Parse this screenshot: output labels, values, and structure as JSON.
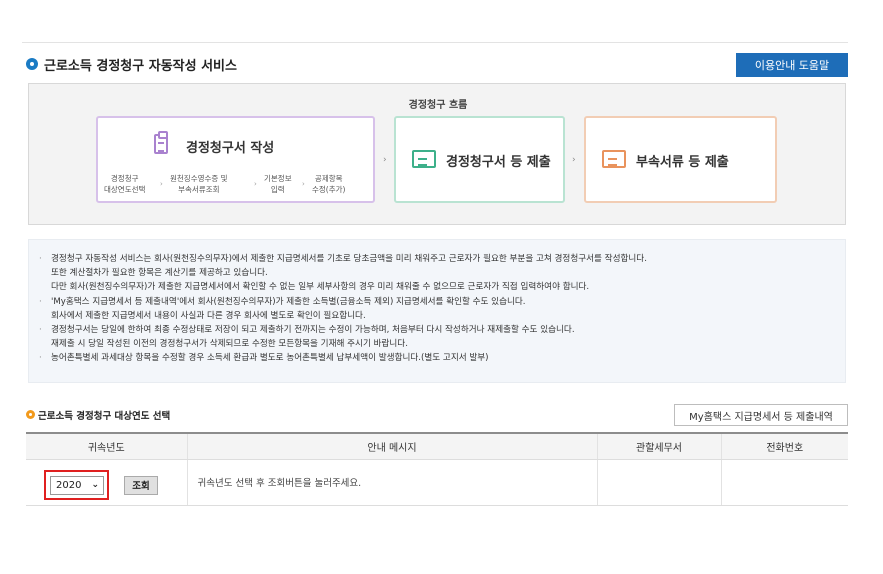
{
  "page_title": "근로소득 경정청구 자동작성 서비스",
  "help_button": "이용안내 도움말",
  "flow": {
    "title": "경정청구 흐름",
    "step1": {
      "label": "경정청구서 작성",
      "subs": [
        {
          "line1": "경정청구",
          "line2": "대상연도선택"
        },
        {
          "line1": "원천징수영수증 및",
          "line2": "부속서류조회"
        },
        {
          "line1": "기본정보",
          "line2": "입력"
        },
        {
          "line1": "공제항목",
          "line2": "수정(추가)"
        }
      ]
    },
    "step2": {
      "label": "경정청구서 등 제출"
    },
    "step3": {
      "label": "부속서류 등 제출"
    }
  },
  "notice": [
    {
      "bullet": true,
      "text": "경정청구 자동작성 서비스는 회사(원천징수의무자)에서 제출한 지급명세서를 기초로 당초금액을 미리 채워주고 근로자가 필요한 부분을 고쳐 경정청구서를 작성합니다."
    },
    {
      "bullet": false,
      "text": "또한 계산절차가 필요한 항목은 계산기를 제공하고 있습니다."
    },
    {
      "bullet": false,
      "text": "다만 회사(원천징수의무자)가 제출한 지급명세서에서 확인할 수 없는 일부 세부사항의 경우 미리 채워줄 수 없으므로 근로자가 직접 입력하여야 합니다."
    },
    {
      "bullet": true,
      "text": "'My홈택스 지급명세서 등 제출내역'에서 회사(원천징수의무자)가 제출한 소득별(금융소득 제외) 지급명세서를 확인할 수도 있습니다."
    },
    {
      "bullet": false,
      "text": "회사에서 제출한 지급명세서 내용이 사실과 다른 경우 회사에 별도로 확인이 필요합니다."
    },
    {
      "bullet": true,
      "text": "경정청구서는 당일에 한하여 최종 수정상태로 저장이 되고 제출하기 전까지는 수정이 가능하며, 처음부터 다시 작성하거나 재제출할 수도 있습니다."
    },
    {
      "bullet": false,
      "text": "재제출 시 당일 작성된 이전의 경정청구서가 삭제되므로 수정한 모든항목을 기재해 주시기 바랍니다."
    },
    {
      "bullet": true,
      "text": "농어촌특별세 과세대상 항목을 수정할 경우 소득세 환급과 별도로 농어촌특별세 납부세액이 발생합니다.(별도 고지서 발부)"
    }
  ],
  "section2": {
    "title": "근로소득 경정청구 대상연도 선택",
    "myhometax_button": "My홈택스 지급명세서 등 제출내역"
  },
  "table": {
    "headers": [
      "귀속년도",
      "안내 메시지",
      "관할세무서",
      "전화번호"
    ],
    "year_value": "2020",
    "search_button": "조회",
    "message": "귀속년도 선택 후 조회버튼을 눌러주세요.",
    "tax_office": "",
    "phone": ""
  },
  "colors": {
    "accent_blue": "#1e6db8",
    "highlight_red": "#e02020",
    "section_orange": "#f29a1c"
  },
  "icons": [
    "clipboard-icon",
    "document-icon",
    "chevron-down-icon"
  ]
}
